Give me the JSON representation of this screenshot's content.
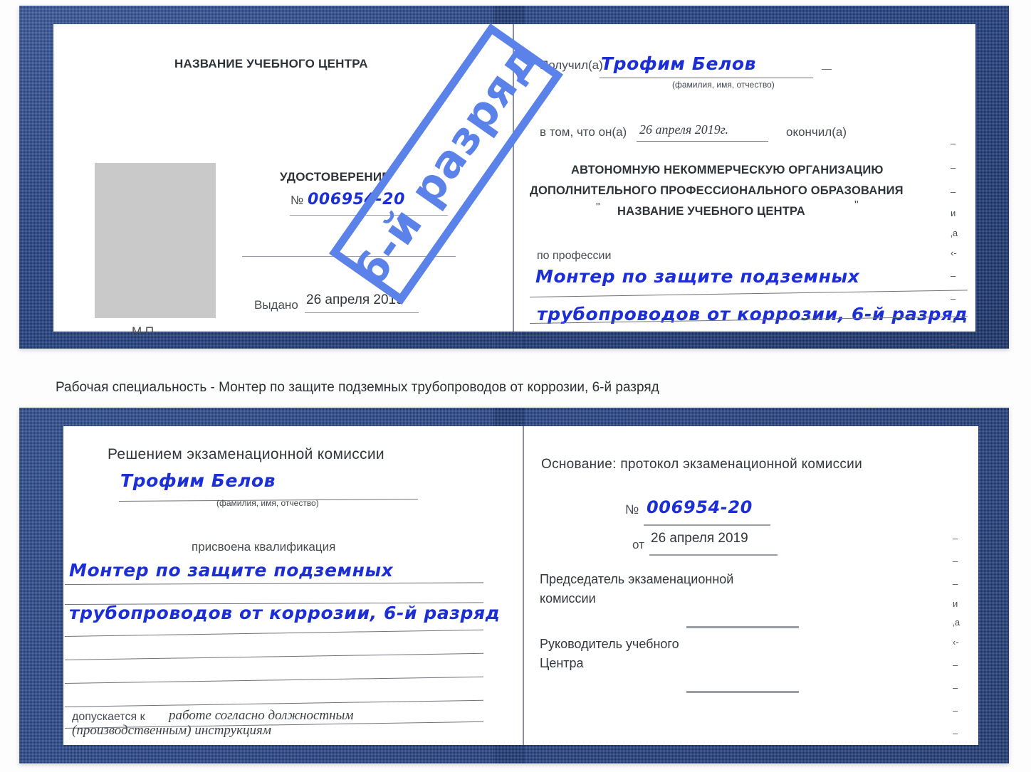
{
  "caption": {
    "text": "Рабочая специальность - Монтер по защите подземных трубопроводов от коррозии, 6-й разряд"
  },
  "watermark": {
    "label": "6-й разряд",
    "color": "#5b82e8"
  },
  "colors": {
    "cover_blue": "#27468b",
    "ink_blue": "#1c2fd6",
    "photo_gray": "#c9c9c9",
    "rule_gray": "#9a9ea4"
  },
  "certificate_top": {
    "left_page": {
      "center_name_heading": "НАЗВАНИЕ УЧЕБНОГО ЦЕНТРА",
      "doc_type": "УДОСТОВЕРЕНИЕ",
      "number_symbol": "№",
      "number_value": "006954-20",
      "issued_label": "Выдано",
      "issued_value": "26 апреля 2019",
      "seal_label": "М.П.",
      "photo_placeholder": "photo-placeholder"
    },
    "right_page": {
      "received_label": "Получил(а)",
      "received_value": "Трофим Белов",
      "fio_hint": "(фамилия, имя, отчество)",
      "in_that_label": "в том, что он(а)",
      "completion_date": "26 апреля 2019г.",
      "finished_label": "окончил(а)",
      "org_line_1": "АВТОНОМНУЮ НЕКОММЕРЧЕСКУЮ ОРГАНИЗАЦИЮ",
      "org_line_2": "ДОПОЛНИТЕЛЬНОГО ПРОФЕССИОНАЛЬНОГО ОБРАЗОВАНИЯ",
      "org_quote_open": "\"",
      "org_line_3": "НАЗВАНИЕ УЧЕБНОГО ЦЕНТРА",
      "org_quote_close": "\"",
      "profession_label": "по профессии",
      "profession_line_1": "Монтер по защите подземных",
      "profession_line_2": "трубопроводов от коррозии, 6-й разряд",
      "edge_fragments": [
        "–",
        "–",
        "–",
        "и",
        "‚а",
        "‹-",
        "–",
        "–",
        "–",
        "–"
      ]
    }
  },
  "certificate_bottom": {
    "left_page": {
      "heading": "Решением экзаменационной комиссии",
      "name_value": "Трофим Белов",
      "fio_hint": "(фамилия, имя, отчество)",
      "qualification_label": "присвоена квалификация",
      "qualification_line_1": "Монтер по защите подземных",
      "qualification_line_2": "трубопроводов от коррозии, 6-й разряд",
      "admitted_label": "допускается к",
      "admitted_value_1": "работе согласно должностным",
      "admitted_value_2": "(производственным) инструкциям"
    },
    "right_page": {
      "basis_label": "Основание: протокол экзаменационной комиссии",
      "number_symbol": "№",
      "number_value": "006954-20",
      "from_label": "от",
      "from_value": "26 апреля 2019",
      "chairman_line_1": "Председатель экзаменационной",
      "chairman_line_2": "комиссии",
      "head_line_1": "Руководитель учебного",
      "head_line_2": "Центра",
      "edge_fragments": [
        "–",
        "–",
        "–",
        "и",
        "‚а",
        "‹-",
        "–",
        "–",
        "–",
        "–"
      ]
    }
  }
}
